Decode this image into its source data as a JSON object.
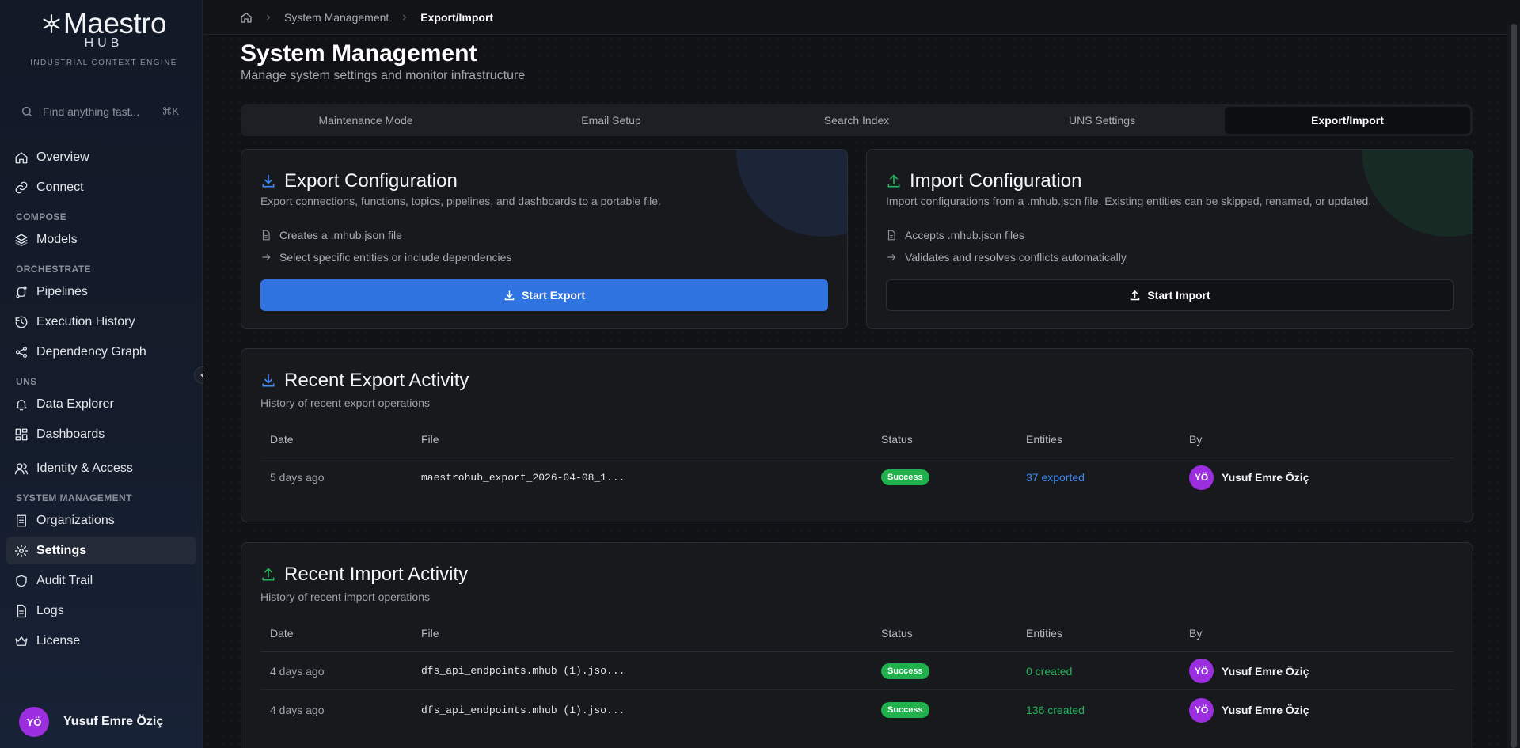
{
  "brand": {
    "name": "Maestro",
    "hub": "HUB",
    "tagline": "INDUSTRIAL CONTEXT ENGINE"
  },
  "search": {
    "placeholder": "Find anything fast...",
    "shortcut": "⌘K"
  },
  "sidebar": {
    "items": [
      {
        "label": "Overview",
        "icon": "home-icon"
      },
      {
        "label": "Connect",
        "icon": "link-icon"
      },
      {
        "group": "COMPOSE"
      },
      {
        "label": "Models",
        "icon": "layers-icon"
      },
      {
        "group": "ORCHESTRATE"
      },
      {
        "label": "Pipelines",
        "icon": "pipeline-icon"
      },
      {
        "label": "Execution History",
        "icon": "history-icon"
      },
      {
        "label": "Dependency Graph",
        "icon": "share-icon"
      },
      {
        "group": "UNS"
      },
      {
        "label": "Data Explorer",
        "icon": "bell-icon"
      },
      {
        "label": "Dashboards",
        "icon": "grid-icon"
      },
      {
        "label": "Identity & Access",
        "icon": "users-icon"
      },
      {
        "group": "SYSTEM MANAGEMENT"
      },
      {
        "label": "Organizations",
        "icon": "building-icon"
      },
      {
        "label": "Settings",
        "icon": "gear-icon",
        "active": true
      },
      {
        "label": "Audit Trail",
        "icon": "shield-icon"
      },
      {
        "label": "Logs",
        "icon": "file-icon"
      },
      {
        "label": "License",
        "icon": "crown-icon"
      }
    ]
  },
  "user": {
    "initials": "YÖ",
    "name": "Yusuf Emre Öziç"
  },
  "breadcrumb": {
    "section": "System Management",
    "current": "Export/Import"
  },
  "page": {
    "title": "System Management",
    "subtitle": "Manage system settings and monitor infrastructure"
  },
  "tabs": [
    {
      "label": "Maintenance Mode"
    },
    {
      "label": "Email Setup"
    },
    {
      "label": "Search Index"
    },
    {
      "label": "UNS Settings"
    },
    {
      "label": "Export/Import",
      "active": true
    }
  ],
  "export_card": {
    "title": "Export Configuration",
    "description": "Export connections, functions, topics, pipelines, and dashboards to a portable file.",
    "feature1": "Creates a .mhub.json file",
    "feature2": "Select specific entities or include dependencies",
    "button": "Start Export"
  },
  "import_card": {
    "title": "Import Configuration",
    "description": "Import configurations from a .mhub.json file. Existing entities can be skipped, renamed, or updated.",
    "feature1": "Accepts .mhub.json files",
    "feature2": "Validates and resolves conflicts automatically",
    "button": "Start Import"
  },
  "columns": {
    "date": "Date",
    "file": "File",
    "status": "Status",
    "entities": "Entities",
    "by": "By"
  },
  "export_activity": {
    "title": "Recent Export Activity",
    "subtitle": "History of recent export operations",
    "rows": [
      {
        "date": "5 days ago",
        "file": "maestrohub_export_2026-04-08_1...",
        "status": "Success",
        "entities": "37 exported",
        "initials": "YÖ",
        "by": "Yusuf Emre Öziç"
      }
    ]
  },
  "import_activity": {
    "title": "Recent Import Activity",
    "subtitle": "History of recent import operations",
    "rows": [
      {
        "date": "4 days ago",
        "file": "dfs_api_endpoints.mhub (1).jso...",
        "status": "Success",
        "entities": "0 created",
        "initials": "YÖ",
        "by": "Yusuf Emre Öziç"
      },
      {
        "date": "4 days ago",
        "file": "dfs_api_endpoints.mhub (1).jso...",
        "status": "Success",
        "entities": "136 created",
        "initials": "YÖ",
        "by": "Yusuf Emre Öziç"
      }
    ]
  },
  "colors": {
    "accent": "#2f74e1",
    "success": "#20b14c",
    "avatar": "#9b2fe0",
    "import_icon": "#25b45a",
    "export_icon": "#3d8af7"
  }
}
